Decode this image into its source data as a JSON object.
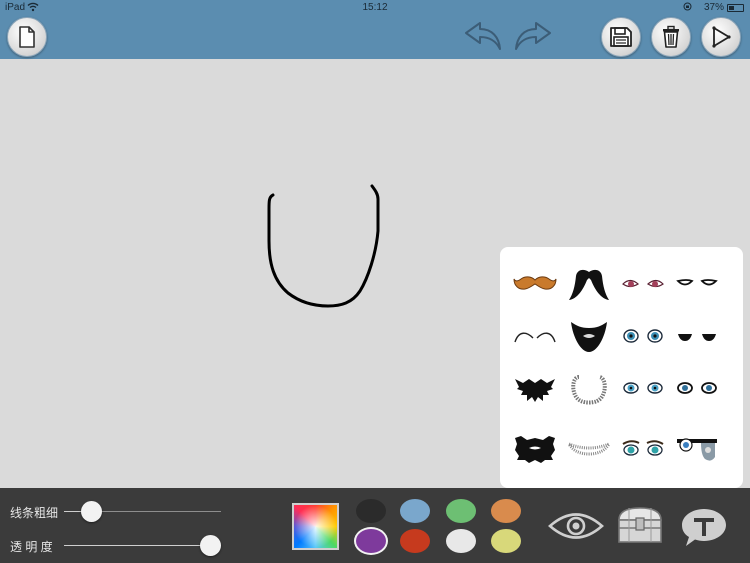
{
  "status_bar": {
    "carrier": "iPad",
    "time": "15:12",
    "battery": "37%"
  },
  "header": {
    "buttons": [
      {
        "name": "new-document",
        "icon": "document-icon"
      },
      {
        "name": "undo",
        "icon": "undo-arrow-icon"
      },
      {
        "name": "redo",
        "icon": "redo-arrow-icon"
      },
      {
        "name": "save",
        "icon": "floppy-disk-icon"
      },
      {
        "name": "delete",
        "icon": "trash-icon"
      },
      {
        "name": "play",
        "icon": "play-triangle-icon"
      }
    ]
  },
  "stickers": {
    "rows": [
      [
        "orange-mustache",
        "black-mustache",
        "pink-eyes",
        "outline-eyes"
      ],
      [
        "thin-mustache",
        "full-beard",
        "blue-anime-eyes",
        "black-eyes"
      ],
      [
        "spiky-beard",
        "stubble-circle-beard",
        "cyan-eyes",
        "small-blue-eyes"
      ],
      [
        "bushy-beard",
        "stubble-beard",
        "teal-eyes",
        "zombie-eyes"
      ]
    ]
  },
  "toolbar": {
    "line_width_label": "线条粗细",
    "opacity_label": "透 明 度",
    "line_width_value": 0.12,
    "opacity_value": 1.0,
    "colors": [
      {
        "name": "black",
        "hex": "#2b2b2b"
      },
      {
        "name": "light-blue",
        "hex": "#7aa7cc"
      },
      {
        "name": "green",
        "hex": "#6dbf73"
      },
      {
        "name": "orange",
        "hex": "#d98b4d"
      },
      {
        "name": "purple",
        "hex": "#7e3a9c"
      },
      {
        "name": "red",
        "hex": "#c63a1e"
      },
      {
        "name": "white",
        "hex": "#e8e8e8"
      },
      {
        "name": "yellow-green",
        "hex": "#d8d87a"
      }
    ],
    "selected_color": "purple",
    "tools": [
      "eye-icon",
      "treasure-chest-icon",
      "text-bubble-icon"
    ]
  },
  "accent": {
    "header_bg": "#5b8db0",
    "canvas_bg": "#dadada",
    "toolbar_bg": "#3b3b3b"
  }
}
